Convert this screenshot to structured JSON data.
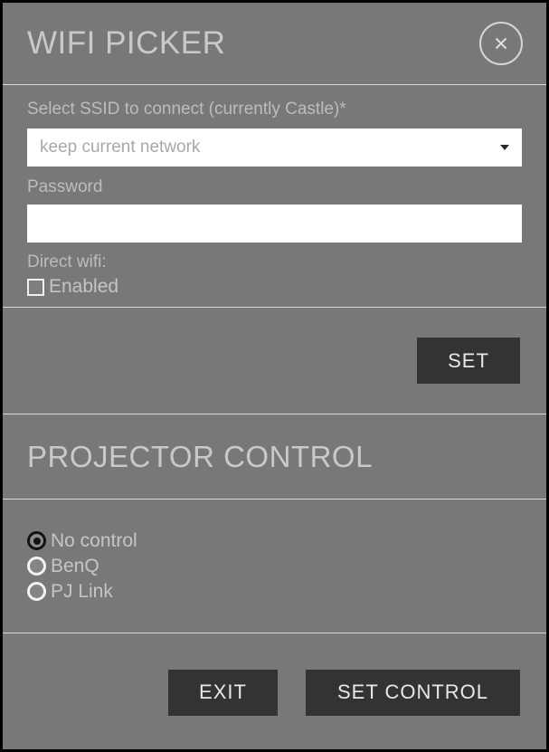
{
  "window": {
    "background_color": "#787878",
    "border_color": "#000000"
  },
  "header": {
    "title": "WIFI PICKER",
    "close_icon": "close-circle-icon"
  },
  "wifi_form": {
    "ssid_label": "Select SSID to connect (currently Castle)*",
    "ssid_select": {
      "value": "keep current network",
      "options": [
        "keep current network"
      ],
      "caret_icon": "chevron-down-icon"
    },
    "password_label": "Password",
    "password_value": "",
    "password_placeholder": "",
    "direct_wifi_label": "Direct wifi:",
    "direct_wifi_checkbox": {
      "label": "Enabled",
      "checked": false
    }
  },
  "wifi_actions": {
    "set_label": "SET"
  },
  "projector": {
    "heading": "PROJECTOR CONTROL",
    "control_options": [
      {
        "label": "No control",
        "selected": true
      },
      {
        "label": "BenQ",
        "selected": false
      },
      {
        "label": "PJ Link",
        "selected": false
      }
    ]
  },
  "footer": {
    "exit_label": "EXIT",
    "set_control_label": "SET CONTROL"
  }
}
